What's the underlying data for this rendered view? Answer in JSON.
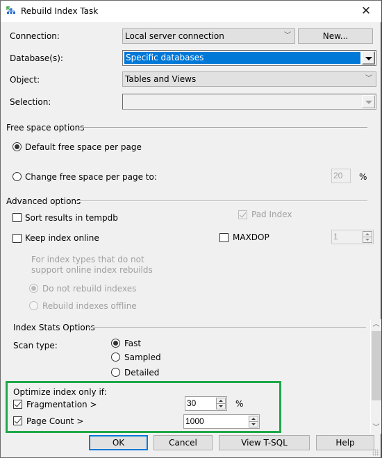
{
  "window": {
    "title": "Rebuild Index Task",
    "icon": "index-task-icon",
    "close_icon": "close-icon"
  },
  "form": {
    "connection": {
      "label": "Connection:",
      "value": "Local server connection",
      "new_button": "New..."
    },
    "databases": {
      "label": "Database(s):",
      "value": "Specific databases"
    },
    "object": {
      "label": "Object:",
      "value": "Tables and Views"
    },
    "selection": {
      "label": "Selection:",
      "value": ""
    }
  },
  "free_space": {
    "heading": "Free space options",
    "default_option": {
      "label": "Default free space per page",
      "selected": true
    },
    "change_option": {
      "label": "Change free space per page to:",
      "selected": false
    },
    "percent_value": "20",
    "percent_unit": "%"
  },
  "advanced": {
    "heading": "Advanced options",
    "sort_tempdb": {
      "label": "Sort results in tempdb",
      "checked": false
    },
    "pad_index": {
      "label": "Pad Index",
      "checked": true,
      "enabled": false
    },
    "keep_online": {
      "label": "Keep index online",
      "checked": false
    },
    "maxdop": {
      "label": "MAXDOP",
      "checked": false,
      "value": "1"
    },
    "online_note": "For index types that do not support online index rebuilds",
    "online_note_line1": "For index types that do not",
    "online_note_line2": "support online index rebuilds",
    "do_not_rebuild": {
      "label": "Do not rebuild indexes",
      "selected": true,
      "enabled": false
    },
    "rebuild_offline": {
      "label": "Rebuild indexes offline",
      "selected": false,
      "enabled": false
    }
  },
  "index_stats": {
    "heading": "Index Stats Options",
    "scan_type_label": "Scan type:",
    "options": [
      {
        "label": "Fast",
        "selected": true
      },
      {
        "label": "Sampled",
        "selected": false
      },
      {
        "label": "Detailed",
        "selected": false
      }
    ]
  },
  "optimize": {
    "heading": "Optimize index only if:",
    "fragmentation": {
      "label": "Fragmentation >",
      "checked": true,
      "value": "30",
      "unit": "%"
    },
    "page_count": {
      "label": "Page Count >",
      "checked": true,
      "value": "1000"
    },
    "highlight_color": "#1fa84a"
  },
  "buttons": {
    "ok": "OK",
    "cancel": "Cancel",
    "view_tsql": "View T-SQL",
    "help": "Help"
  },
  "colors": {
    "accent": "#0078d7",
    "dialog_bg": "#f0f0f0",
    "highlight": "#1fa84a"
  }
}
